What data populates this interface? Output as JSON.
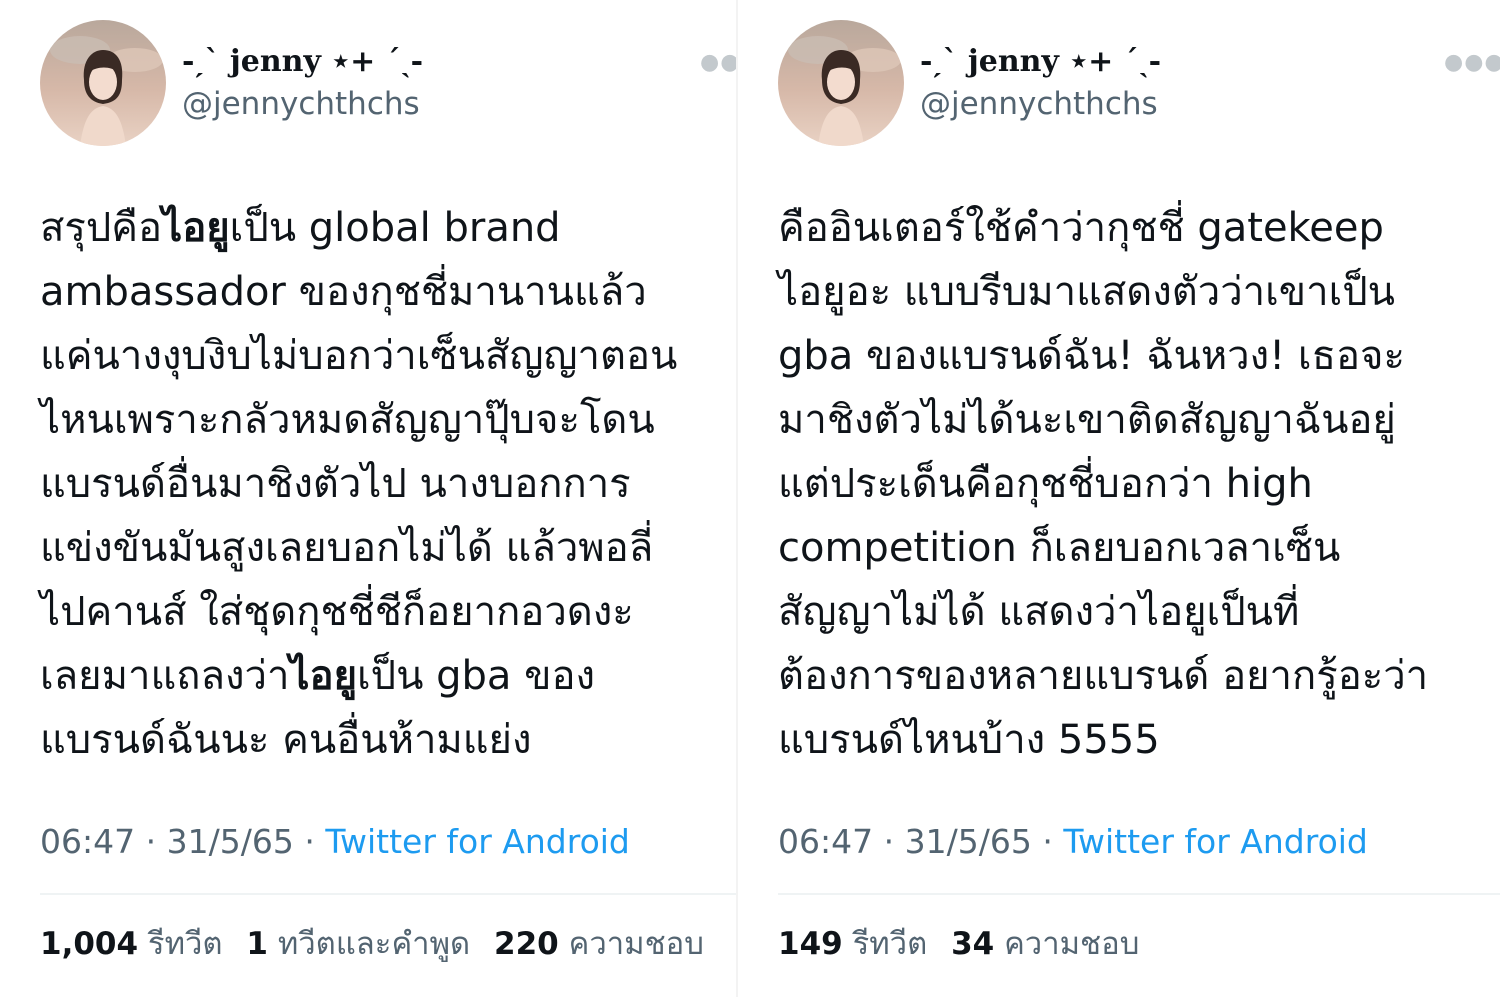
{
  "left_tweet": {
    "display_name": "-ˏˋ jenny ⋆+ ˊˎ-",
    "handle": "@jennychthchs",
    "more_icon": "more-dots-icon",
    "lines": [
      {
        "segments": [
          {
            "text": "สรุปคือ",
            "bold": false
          },
          {
            "text": "ไอยู",
            "bold": true
          },
          {
            "text": "เป็น global brand",
            "bold": false
          }
        ]
      },
      {
        "segments": [
          {
            "text": "ambassador ของกุชชี่มานานแล้ว",
            "bold": false
          }
        ]
      },
      {
        "segments": [
          {
            "text": "แค่นางงุบงิบไม่บอกว่าเซ็นสัญญาตอน",
            "bold": false
          }
        ]
      },
      {
        "segments": [
          {
            "text": "ไหนเพราะกลัวหมดสัญญาปุ๊บจะโดน",
            "bold": false
          }
        ]
      },
      {
        "segments": [
          {
            "text": "แบรนด์อื่นมาชิงตัวไป นางบอกการ",
            "bold": false
          }
        ]
      },
      {
        "segments": [
          {
            "text": "แข่งขันมันสูงเลยบอกไม่ได้ แล้วพอลี่",
            "bold": false
          }
        ]
      },
      {
        "segments": [
          {
            "text": "ไปคานส์ ใส่ชุดกุชชี่ชีก็อยากอวดงะ",
            "bold": false
          }
        ]
      },
      {
        "segments": [
          {
            "text": "เลยมาแถลงว่า",
            "bold": false
          },
          {
            "text": "ไอยู",
            "bold": true
          },
          {
            "text": "เป็น gba ของ",
            "bold": false
          }
        ]
      },
      {
        "segments": [
          {
            "text": "แบรนด์ฉันนะ คนอื่นห้ามแย่ง",
            "bold": false
          }
        ]
      }
    ],
    "time": "06:47",
    "date": "31/5/65",
    "separator": "·",
    "source": "Twitter for Android",
    "stats": [
      {
        "count": "1,004",
        "label": "รีทวีต"
      },
      {
        "count": "1",
        "label": "ทวีตและคำพูด"
      },
      {
        "count": "220",
        "label": "ความชอบ"
      }
    ]
  },
  "right_tweet": {
    "display_name": "-ˏˋ jenny ⋆+ ˊˎ-",
    "handle": "@jennychthchs",
    "more_icon": "more-dots-icon",
    "lines": [
      {
        "segments": [
          {
            "text": "คืออินเตอร์ใช้คำว่ากุชชี่ gatekeep",
            "bold": false
          }
        ]
      },
      {
        "segments": [
          {
            "text": "ไอยูอะ แบบรีบมาแสดงตัวว่าเขาเป็น",
            "bold": false
          }
        ]
      },
      {
        "segments": [
          {
            "text": "gba ของแบรนด์ฉัน! ฉันหวง! เธอจะ",
            "bold": false
          }
        ]
      },
      {
        "segments": [
          {
            "text": "มาชิงตัวไม่ได้นะเขาติดสัญญาฉันอยู่",
            "bold": false
          }
        ]
      },
      {
        "segments": [
          {
            "text": "แต่ประเด็นคือกุชชี่บอกว่า high",
            "bold": false
          }
        ]
      },
      {
        "segments": [
          {
            "text": "competition ก็เลยบอกเวลาเซ็น",
            "bold": false
          }
        ]
      },
      {
        "segments": [
          {
            "text": "สัญญาไม่ได้ แสดงว่าไอยูเป็นที่",
            "bold": false
          }
        ]
      },
      {
        "segments": [
          {
            "text": "ต้องการของหลายแบรนด์ อยากรู้อะว่า",
            "bold": false
          }
        ]
      },
      {
        "segments": [
          {
            "text": "แบรนด์ไหนบ้าง 5555",
            "bold": false
          }
        ]
      }
    ],
    "time": "06:47",
    "date": "31/5/65",
    "separator": "·",
    "source": "Twitter for Android",
    "stats": [
      {
        "count": "149",
        "label": "รีทวีต"
      },
      {
        "count": "34",
        "label": "ความชอบ"
      }
    ]
  },
  "colors": {
    "text_primary": "#0f1419",
    "text_secondary": "#536471",
    "link": "#1d9bf0",
    "divider": "#eff3f4"
  }
}
